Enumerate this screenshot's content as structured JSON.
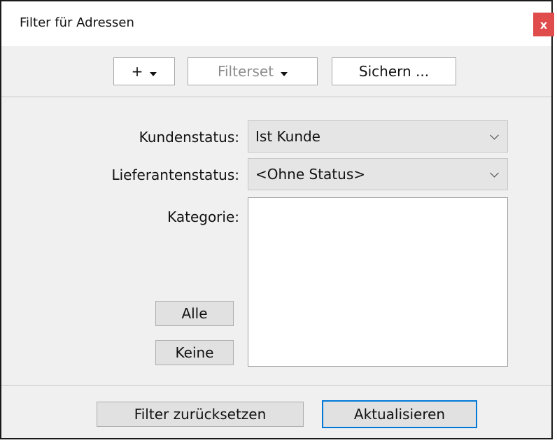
{
  "window": {
    "title": "Filter für Adressen",
    "close_label": "x",
    "close_color": "#e04b4b"
  },
  "toolbar": {
    "add_label": "+",
    "filterset_label": "Filterset",
    "save_label": "Sichern ..."
  },
  "form": {
    "kundenstatus_label": "Kundenstatus:",
    "kundenstatus_value": "Ist Kunde",
    "lieferantenstatus_label": "Lieferantenstatus:",
    "lieferantenstatus_value": "<Ohne Status>",
    "kategorie_label": "Kategorie:",
    "kategorie_items": [],
    "all_label": "Alle",
    "none_label": "Keine"
  },
  "footer": {
    "reset_label": "Filter zurücksetzen",
    "refresh_label": "Aktualisieren"
  },
  "colors": {
    "accent": "#0078d7",
    "panel_bg": "#f0f0f0"
  }
}
